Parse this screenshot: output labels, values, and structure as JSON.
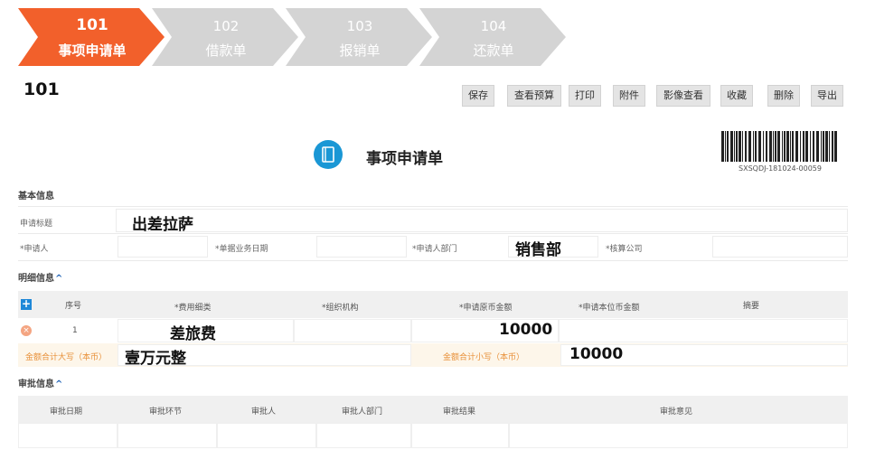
{
  "steps": [
    {
      "num": "101",
      "label": "事项申请单",
      "active": true
    },
    {
      "num": "102",
      "label": "借款单",
      "active": false
    },
    {
      "num": "103",
      "label": "报销单",
      "active": false
    },
    {
      "num": "104",
      "label": "还款单",
      "active": false
    }
  ],
  "colors": {
    "active_step": "#f2602b",
    "inactive_step": "#d4d4d4",
    "accent_blue": "#1a97d5",
    "total_orange": "#e8913a"
  },
  "page_code": "101",
  "toolbar": {
    "save": "保存",
    "view_budget": "查看预算",
    "print": "打印",
    "attachment": "附件",
    "image_view": "影像查看",
    "favorite": "收藏",
    "delete": "删除",
    "export": "导出"
  },
  "form": {
    "icon": "document-icon",
    "title": "事项申请单",
    "barcode_text": "SXSQDJ-181024-00059"
  },
  "basic_info": {
    "section": "基本信息",
    "title_label": "申请标题",
    "title_value": "出差拉萨",
    "applicant_label": "*申请人",
    "applicant_value": "",
    "business_date_label": "*单据业务日期",
    "business_date_value": "",
    "department_label": "*申请人部门",
    "department_value": "销售部",
    "company_label": "*核算公司",
    "company_value": ""
  },
  "detail_info": {
    "section": "明细信息",
    "caret": "^",
    "columns": [
      "序号",
      "*费用细类",
      "*组织机构",
      "*申请原币金额",
      "*申请本位币金额",
      "摘要"
    ],
    "rows": [
      {
        "index": "1",
        "expense_type": "差旅费",
        "org": "",
        "amount": "10000",
        "local_amount": "",
        "summary": ""
      }
    ],
    "total_upper_label": "金额合计大写（本币）",
    "total_upper_value": "壹万元整",
    "total_lower_label": "金额合计小写（本币）",
    "total_lower_value": "10000"
  },
  "approval_info": {
    "section": "审批信息",
    "caret": "^",
    "columns": [
      "审批日期",
      "审批环节",
      "审批人",
      "审批人部门",
      "审批结果",
      "审批意见"
    ]
  }
}
